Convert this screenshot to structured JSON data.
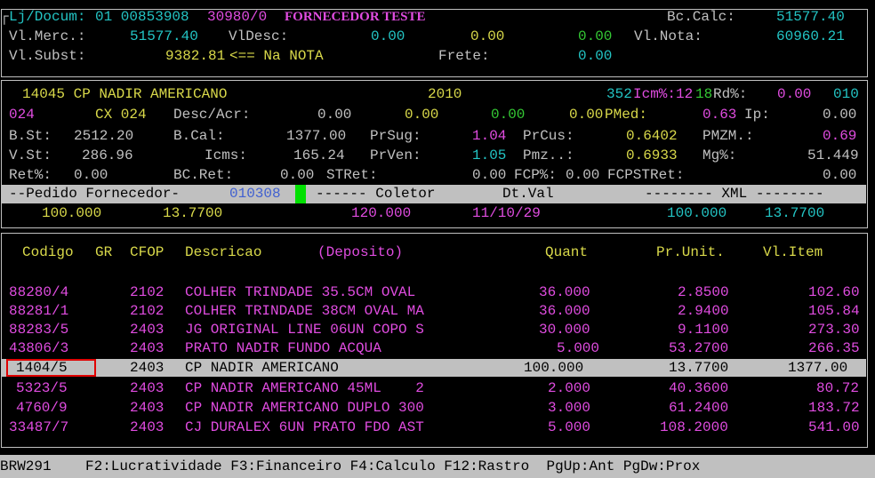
{
  "header": {
    "lj_label": "Lj/Docum:",
    "lj_value": "01 00853908",
    "doc_value": "30980/0",
    "fornecedor": "FORNECEDOR TESTE",
    "bc_calc_label": "Bc.Calc:",
    "bc_calc_value": "51577.40",
    "vl_merc_label": "Vl.Merc.:",
    "vl_merc_value": "51577.40",
    "vl_desc_label": "VlDesc:",
    "vl_desc_1": "0.00",
    "vl_desc_2": "0.00",
    "vl_desc_3": "0.00",
    "vl_nota_label": "Vl.Nota:",
    "vl_nota_value": "60960.21",
    "vl_subst_label": "Vl.Subst:",
    "vl_subst_value": "9382.81",
    "na_nota": "<== Na NOTA",
    "frete_label": "Frete:",
    "frete_value": "0.00"
  },
  "product": {
    "code_name": "14045 CP NADIR AMERICANO",
    "year": "2010",
    "icm_prefix": "352",
    "icm_label": "Icm%:12",
    "icm_rd": "18",
    "rd_label": "Rd%:",
    "rd_value": "0.00",
    "rd_tail": "010",
    "r2_code": "024",
    "r2_cx": "CX 024",
    "desc_acr_label": "Desc/Acr:",
    "desc_1": "0.00",
    "desc_2": "0.00",
    "desc_3": "0.00",
    "desc_4": "0.00",
    "pmed_label": "PMed:",
    "pmed_value": "0.63",
    "ip_label": "Ip:",
    "ip_value": "0.00",
    "bst_label": "B.St:",
    "bst_value": "2512.20",
    "bcal_label": "B.Cal:",
    "bcal_value": "1377.00",
    "prsug_label": "PrSug:",
    "prsug_value": "1.04",
    "prcus_label": "PrCus:",
    "prcus_value": "0.6402",
    "pmzm_label": "PMZM.:",
    "pmzm_value": "0.69",
    "vst_label": "V.St:",
    "vst_value": "286.96",
    "icms_label": "Icms:",
    "icms_value": "165.24",
    "prven_label": "PrVen:",
    "prven_value": "1.05",
    "pmz_label": "Pmz..:",
    "pmz_value": "0.6933",
    "mg_label": "Mg%:",
    "mg_value": "51.449",
    "ret_label": "Ret%:",
    "ret_value": "0.00",
    "bcret_label": "BC.Ret:",
    "bcret_value": "0.00",
    "stret_label": "STRet:",
    "stret_value": "0.00",
    "fcp_label": "FCP%:",
    "fcp_value": "0.00",
    "fcpst_label": "FCPSTRet:",
    "fcpst_value": "0.00"
  },
  "pedido": {
    "bar_left": "--Pedido Fornecedor-",
    "pedido_num": "010308",
    "bar_mid": "------ Coletor",
    "dtval": "Dt.Val",
    "bar_right": "-------- XML --------",
    "qty": "100.000",
    "price": "13.7700",
    "coletor": "120.000",
    "date": "11/10/29",
    "xml_qty": "100.000",
    "xml_price": "13.7700"
  },
  "table": {
    "headers": {
      "codigo": "Codigo",
      "gr": "GR",
      "cfop": "CFOP",
      "descricao": "Descricao",
      "deposito": "(Deposito)",
      "quant": "Quant",
      "prunit": "Pr.Unit.",
      "vlitem": "Vl.Item"
    },
    "rows": [
      {
        "codigo": "88280/4",
        "cfop": "2102",
        "desc": "COLHER TRINDADE 35.5CM OVAL",
        "quant": "36.000",
        "prunit": "2.8500",
        "vlitem": "102.60"
      },
      {
        "codigo": "88281/1",
        "cfop": "2102",
        "desc": "COLHER TRINDADE 38CM OVAL MA",
        "quant": "36.000",
        "prunit": "2.9400",
        "vlitem": "105.84"
      },
      {
        "codigo": "88283/5",
        "cfop": "2403",
        "desc": "JG ORIGINAL LINE 06UN COPO S",
        "quant": "30.000",
        "prunit": "9.1100",
        "vlitem": "273.30"
      },
      {
        "codigo": "43806/3",
        "cfop": "2403",
        "desc": "PRATO NADIR FUNDO ACQUA",
        "quant": "5.000",
        "prunit": "53.2700",
        "vlitem": "266.35"
      },
      {
        "codigo": "1404/5",
        "cfop": "2403",
        "desc": "CP NADIR AMERICANO",
        "quant": "100.000",
        "prunit": "13.7700",
        "vlitem": "1377.00"
      },
      {
        "codigo": "5323/5",
        "cfop": "2403",
        "desc": "CP NADIR AMERICANO 45ML    2",
        "quant": "2.000",
        "prunit": "40.3600",
        "vlitem": "80.72"
      },
      {
        "codigo": "4760/9",
        "cfop": "2403",
        "desc": "CP NADIR AMERICANO DUPLO 300",
        "quant": "3.000",
        "prunit": "61.2400",
        "vlitem": "183.72"
      },
      {
        "codigo": "33487/7",
        "cfop": "2403",
        "desc": "CJ DURALEX 6UN PRATO FDO AST",
        "quant": "5.000",
        "prunit": "108.2000",
        "vlitem": "541.00"
      }
    ]
  },
  "statusbar": {
    "program": "BRW291",
    "keys": "F2:Lucratividade F3:Financeiro F4:Calculo F12:Rastro  PgUp:Ant PgDw:Prox"
  },
  "colors": {
    "background": "#000000",
    "cyan": "#23c4c4",
    "yellow": "#d9d94a",
    "magenta": "#e04ce0",
    "green": "#34c934",
    "gray": "#c0c0c0",
    "selection_border": "#e00000"
  }
}
